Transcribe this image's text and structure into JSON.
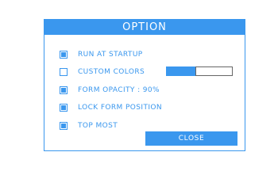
{
  "dialog": {
    "title": "OPTION",
    "options": [
      {
        "label": "RUN AT STARTUP",
        "checked": true
      },
      {
        "label": "CUSTOM COLORS",
        "checked": false
      },
      {
        "label": "FORM OPACITY : 90%",
        "checked": true
      },
      {
        "label": "LOCK FORM POSITION",
        "checked": true
      },
      {
        "label": "TOP MOST",
        "checked": true
      }
    ],
    "close_label": "CLOSE"
  },
  "colors": {
    "accent": "#3a97ee",
    "background": "#ffffff",
    "swatch_secondary_border": "#666666"
  }
}
